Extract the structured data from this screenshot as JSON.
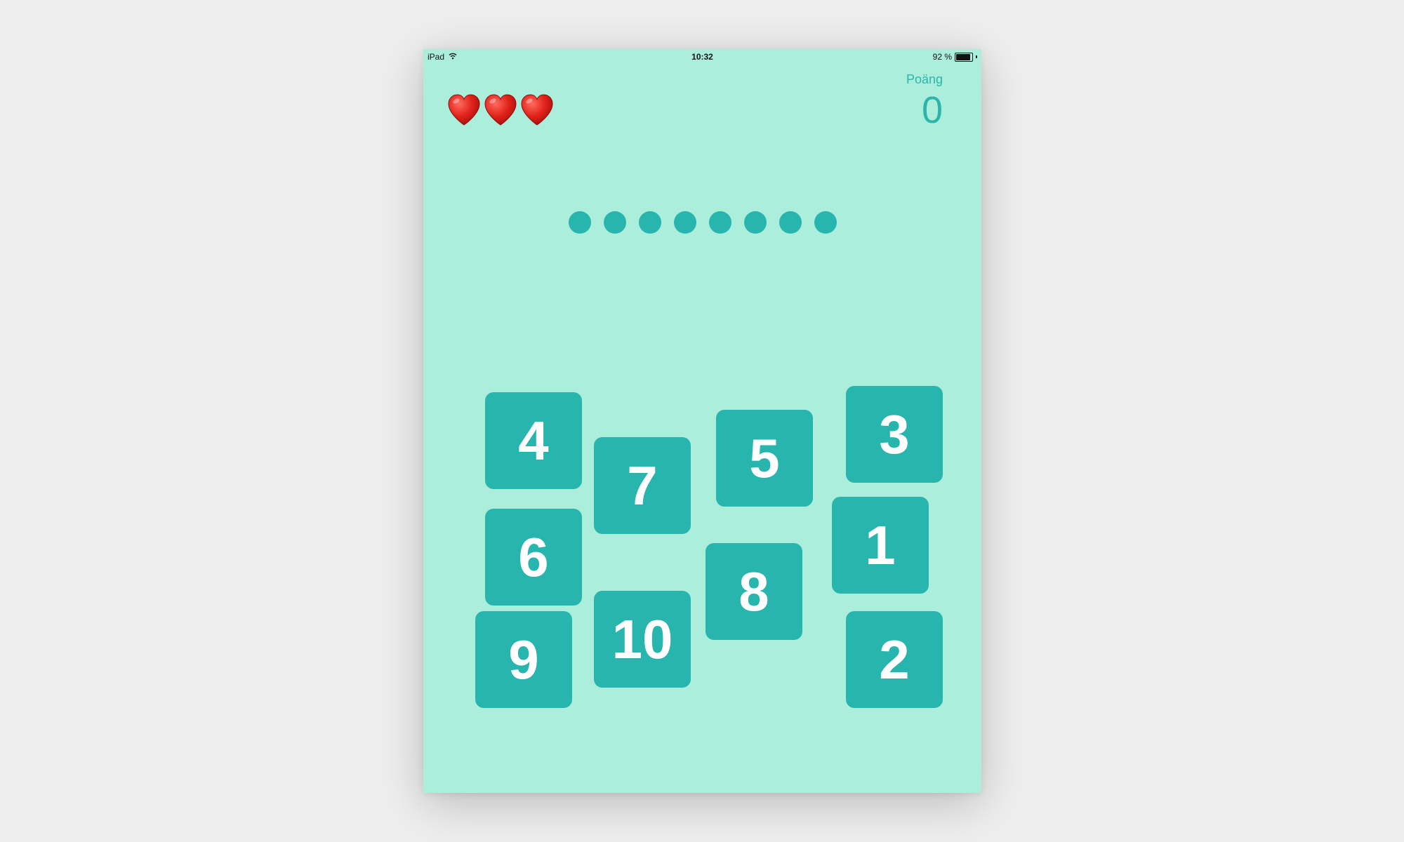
{
  "status_bar": {
    "device": "iPad",
    "wifi_icon": "wifi-icon",
    "time": "10:32",
    "battery_text": "92 %",
    "battery_level": 0.92
  },
  "game": {
    "lives": [
      "heart-icon",
      "heart-icon",
      "heart-icon"
    ],
    "score_label": "Poäng",
    "score_value": "0",
    "progress_dots_count": 8,
    "tiles": [
      "4",
      "7",
      "5",
      "3",
      "6",
      "1",
      "8",
      "9",
      "10",
      "2"
    ]
  },
  "colors": {
    "background": "#abeedc",
    "accent": "#27b5ae",
    "tile_text": "#ffffff",
    "heart": "#e0231b"
  }
}
